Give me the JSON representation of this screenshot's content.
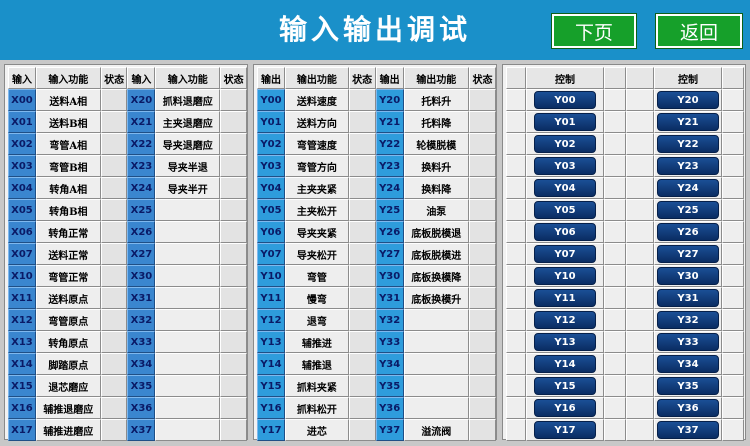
{
  "header": {
    "title": "输入输出调试",
    "next_label": "下页",
    "back_label": "返回"
  },
  "colors": {
    "header_bg": "#1a90c9",
    "button_green": "#16a02a",
    "code_blue": "#3a86cf",
    "control_button": "#0a2d63"
  },
  "inputs": {
    "headers": [
      "输入",
      "输入功能",
      "状态",
      "输入",
      "输入功能",
      "状态"
    ],
    "rows": [
      {
        "a": "X00",
        "af": "送料A相",
        "b": "X20",
        "bf": "抓料退磨应"
      },
      {
        "a": "X01",
        "af": "送料B相",
        "b": "X21",
        "bf": "主夹退磨应"
      },
      {
        "a": "X02",
        "af": "弯管A相",
        "b": "X22",
        "bf": "导夹退磨应"
      },
      {
        "a": "X03",
        "af": "弯管B相",
        "b": "X23",
        "bf": "导夹半退"
      },
      {
        "a": "X04",
        "af": "转角A相",
        "b": "X24",
        "bf": "导夹半开"
      },
      {
        "a": "X05",
        "af": "转角B相",
        "b": "X25",
        "bf": ""
      },
      {
        "a": "X06",
        "af": "转角正常",
        "b": "X26",
        "bf": ""
      },
      {
        "a": "X07",
        "af": "送料正常",
        "b": "X27",
        "bf": ""
      },
      {
        "a": "X10",
        "af": "弯管正常",
        "b": "X30",
        "bf": ""
      },
      {
        "a": "X11",
        "af": "送料原点",
        "b": "X31",
        "bf": ""
      },
      {
        "a": "X12",
        "af": "弯管原点",
        "b": "X32",
        "bf": ""
      },
      {
        "a": "X13",
        "af": "转角原点",
        "b": "X33",
        "bf": ""
      },
      {
        "a": "X14",
        "af": "脚踏原点",
        "b": "X34",
        "bf": ""
      },
      {
        "a": "X15",
        "af": "退芯磨应",
        "b": "X35",
        "bf": ""
      },
      {
        "a": "X16",
        "af": "辅推退磨应",
        "b": "X36",
        "bf": ""
      },
      {
        "a": "X17",
        "af": "辅推进磨应",
        "b": "X37",
        "bf": ""
      }
    ]
  },
  "outputs": {
    "headers": [
      "输出",
      "输出功能",
      "状态",
      "输出",
      "输出功能",
      "状态"
    ],
    "rows": [
      {
        "a": "Y00",
        "af": "送料速度",
        "b": "Y20",
        "bf": "托料升"
      },
      {
        "a": "Y01",
        "af": "送料方向",
        "b": "Y21",
        "bf": "托料降"
      },
      {
        "a": "Y02",
        "af": "弯管速度",
        "b": "Y22",
        "bf": "轮模脱模"
      },
      {
        "a": "Y03",
        "af": "弯管方向",
        "b": "Y23",
        "bf": "换料升"
      },
      {
        "a": "Y04",
        "af": "主夹夹紧",
        "b": "Y24",
        "bf": "换料降"
      },
      {
        "a": "Y05",
        "af": "主夹松开",
        "b": "Y25",
        "bf": "油泵"
      },
      {
        "a": "Y06",
        "af": "导夹夹紧",
        "b": "Y26",
        "bf": "底板脱模退"
      },
      {
        "a": "Y07",
        "af": "导夹松开",
        "b": "Y27",
        "bf": "底板脱模进"
      },
      {
        "a": "Y10",
        "af": "弯管",
        "b": "Y30",
        "bf": "底板换模降"
      },
      {
        "a": "Y11",
        "af": "慢弯",
        "b": "Y31",
        "bf": "底板换模升"
      },
      {
        "a": "Y12",
        "af": "退弯",
        "b": "Y32",
        "bf": ""
      },
      {
        "a": "Y13",
        "af": "辅推进",
        "b": "Y33",
        "bf": ""
      },
      {
        "a": "Y14",
        "af": "辅推退",
        "b": "Y34",
        "bf": ""
      },
      {
        "a": "Y15",
        "af": "抓料夹紧",
        "b": "Y35",
        "bf": ""
      },
      {
        "a": "Y16",
        "af": "抓料松开",
        "b": "Y36",
        "bf": ""
      },
      {
        "a": "Y17",
        "af": "进芯",
        "b": "Y37",
        "bf": "溢流阀"
      }
    ]
  },
  "control": {
    "header": "控制",
    "left": [
      "Y00",
      "Y01",
      "Y02",
      "Y03",
      "Y04",
      "Y05",
      "Y06",
      "Y07",
      "Y10",
      "Y11",
      "Y12",
      "Y13",
      "Y14",
      "Y15",
      "Y16",
      "Y17"
    ],
    "right": [
      "Y20",
      "Y21",
      "Y22",
      "Y23",
      "Y24",
      "Y25",
      "Y26",
      "Y27",
      "Y30",
      "Y31",
      "Y32",
      "Y33",
      "Y34",
      "Y35",
      "Y36",
      "Y37"
    ]
  }
}
